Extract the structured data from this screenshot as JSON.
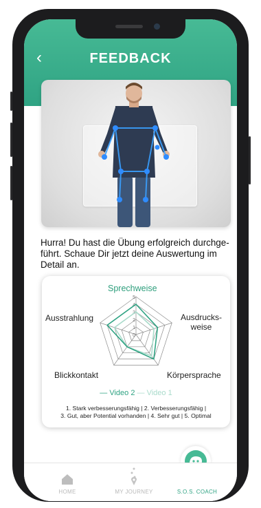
{
  "header": {
    "title": "FEEDBACK",
    "back_icon": "chevron-left-icon",
    "color": "#3bb08d"
  },
  "message": "Hurra! Du hast die Übung erfolgreich durchge-führt. Schaue Dir jetzt deine Auswertung im Detail an.",
  "radar": {
    "axes": [
      "Sprechweise",
      "Ausdrucks-\nweise",
      "Körpersprache",
      "Blickkontakt",
      "Ausstrahlung"
    ],
    "legend": {
      "video2": "— Video 2",
      "video1": "— Video 1"
    },
    "scale_line1": "1. Stark verbesserungsfähig | 2. Verbesserungsfähig |",
    "scale_line2": "3. Gut, aber Potential vorhanden | 4. Sehr gut | 5. Optimal"
  },
  "chart_data": {
    "type": "radar",
    "categories": [
      "Sprechweise",
      "Ausdrucksweise",
      "Körpersprache",
      "Blickkontakt",
      "Ausstrahlung"
    ],
    "rlim": [
      0,
      5
    ],
    "ticks": [
      "5",
      "4",
      "3",
      "2",
      "1",
      "0"
    ],
    "series": [
      {
        "name": "Video 2",
        "values": [
          4,
          3,
          4,
          2,
          4
        ],
        "color": "#2fa383"
      },
      {
        "name": "Video 1",
        "values": [
          3,
          2.5,
          3.5,
          2,
          3
        ],
        "color": "#a9dbcb"
      }
    ]
  },
  "tabs": [
    {
      "label": "HOME",
      "icon": "home-icon",
      "active": false
    },
    {
      "label": "MY JOURNEY",
      "icon": "journey-path-icon",
      "active": false
    },
    {
      "label": "S.O.S. COACH",
      "icon": "coach-icon",
      "active": true
    }
  ]
}
